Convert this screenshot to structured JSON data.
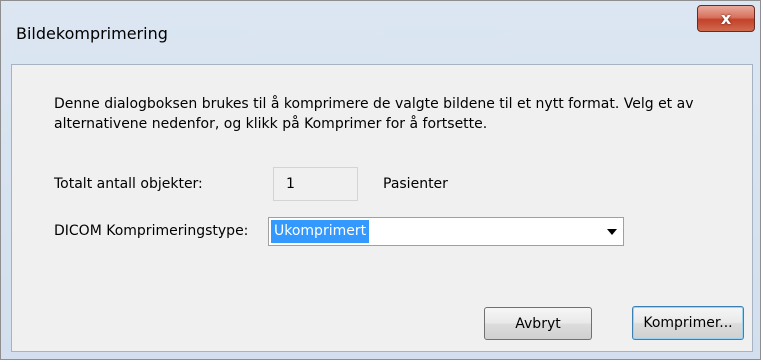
{
  "window": {
    "title": "Bildekomprimering",
    "close_glyph": "x"
  },
  "dialog": {
    "description": "Denne dialogboksen brukes til å komprimere de valgte bildene til et nytt format. Velg et av\nalternativene nedenfor, og klikk på Komprimer for å fortsette.",
    "total_label": "Totalt antall objekter:",
    "total_value": "1",
    "total_unit": "Pasienter",
    "compression_label": "DICOM Komprimeringstype:",
    "compression_value": "Ukomprimert"
  },
  "buttons": {
    "cancel_label": "Avbryt",
    "compress_label": "Komprimer..."
  },
  "colors": {
    "selection": "#3399ff",
    "close_button": "#c3412a"
  }
}
